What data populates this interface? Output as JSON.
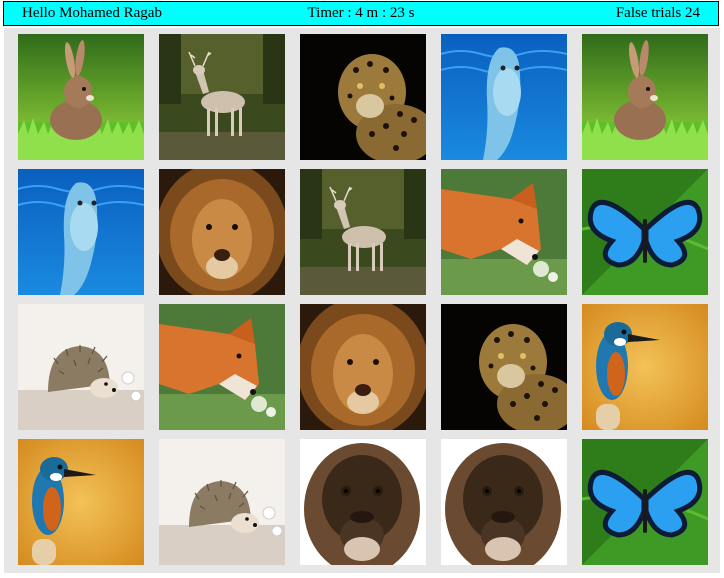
{
  "header": {
    "greeting": "Hello Mohamed Ragab",
    "timer": "Timer : 4 m : 23 s",
    "false_trials": "False trials 24"
  },
  "cards": [
    {
      "row": 0,
      "col": 0,
      "animal": "rabbit"
    },
    {
      "row": 0,
      "col": 1,
      "animal": "deer"
    },
    {
      "row": 0,
      "col": 2,
      "animal": "leopard"
    },
    {
      "row": 0,
      "col": 3,
      "animal": "dolphin"
    },
    {
      "row": 0,
      "col": 4,
      "animal": "rabbit"
    },
    {
      "row": 1,
      "col": 0,
      "animal": "dolphin"
    },
    {
      "row": 1,
      "col": 1,
      "animal": "lion"
    },
    {
      "row": 1,
      "col": 2,
      "animal": "deer"
    },
    {
      "row": 1,
      "col": 3,
      "animal": "fox"
    },
    {
      "row": 1,
      "col": 4,
      "animal": "butterfly"
    },
    {
      "row": 2,
      "col": 0,
      "animal": "hedgehog"
    },
    {
      "row": 2,
      "col": 1,
      "animal": "fox"
    },
    {
      "row": 2,
      "col": 2,
      "animal": "lion"
    },
    {
      "row": 2,
      "col": 3,
      "animal": "leopard"
    },
    {
      "row": 2,
      "col": 4,
      "animal": "kingfisher"
    },
    {
      "row": 3,
      "col": 0,
      "animal": "kingfisher"
    },
    {
      "row": 3,
      "col": 1,
      "animal": "hedgehog"
    },
    {
      "row": 3,
      "col": 2,
      "animal": "gorilla"
    },
    {
      "row": 3,
      "col": 3,
      "animal": "gorilla"
    },
    {
      "row": 3,
      "col": 4,
      "animal": "butterfly"
    }
  ],
  "colors": {
    "header_bg": "#00ffff",
    "board_bg": "#e6e6e6"
  }
}
